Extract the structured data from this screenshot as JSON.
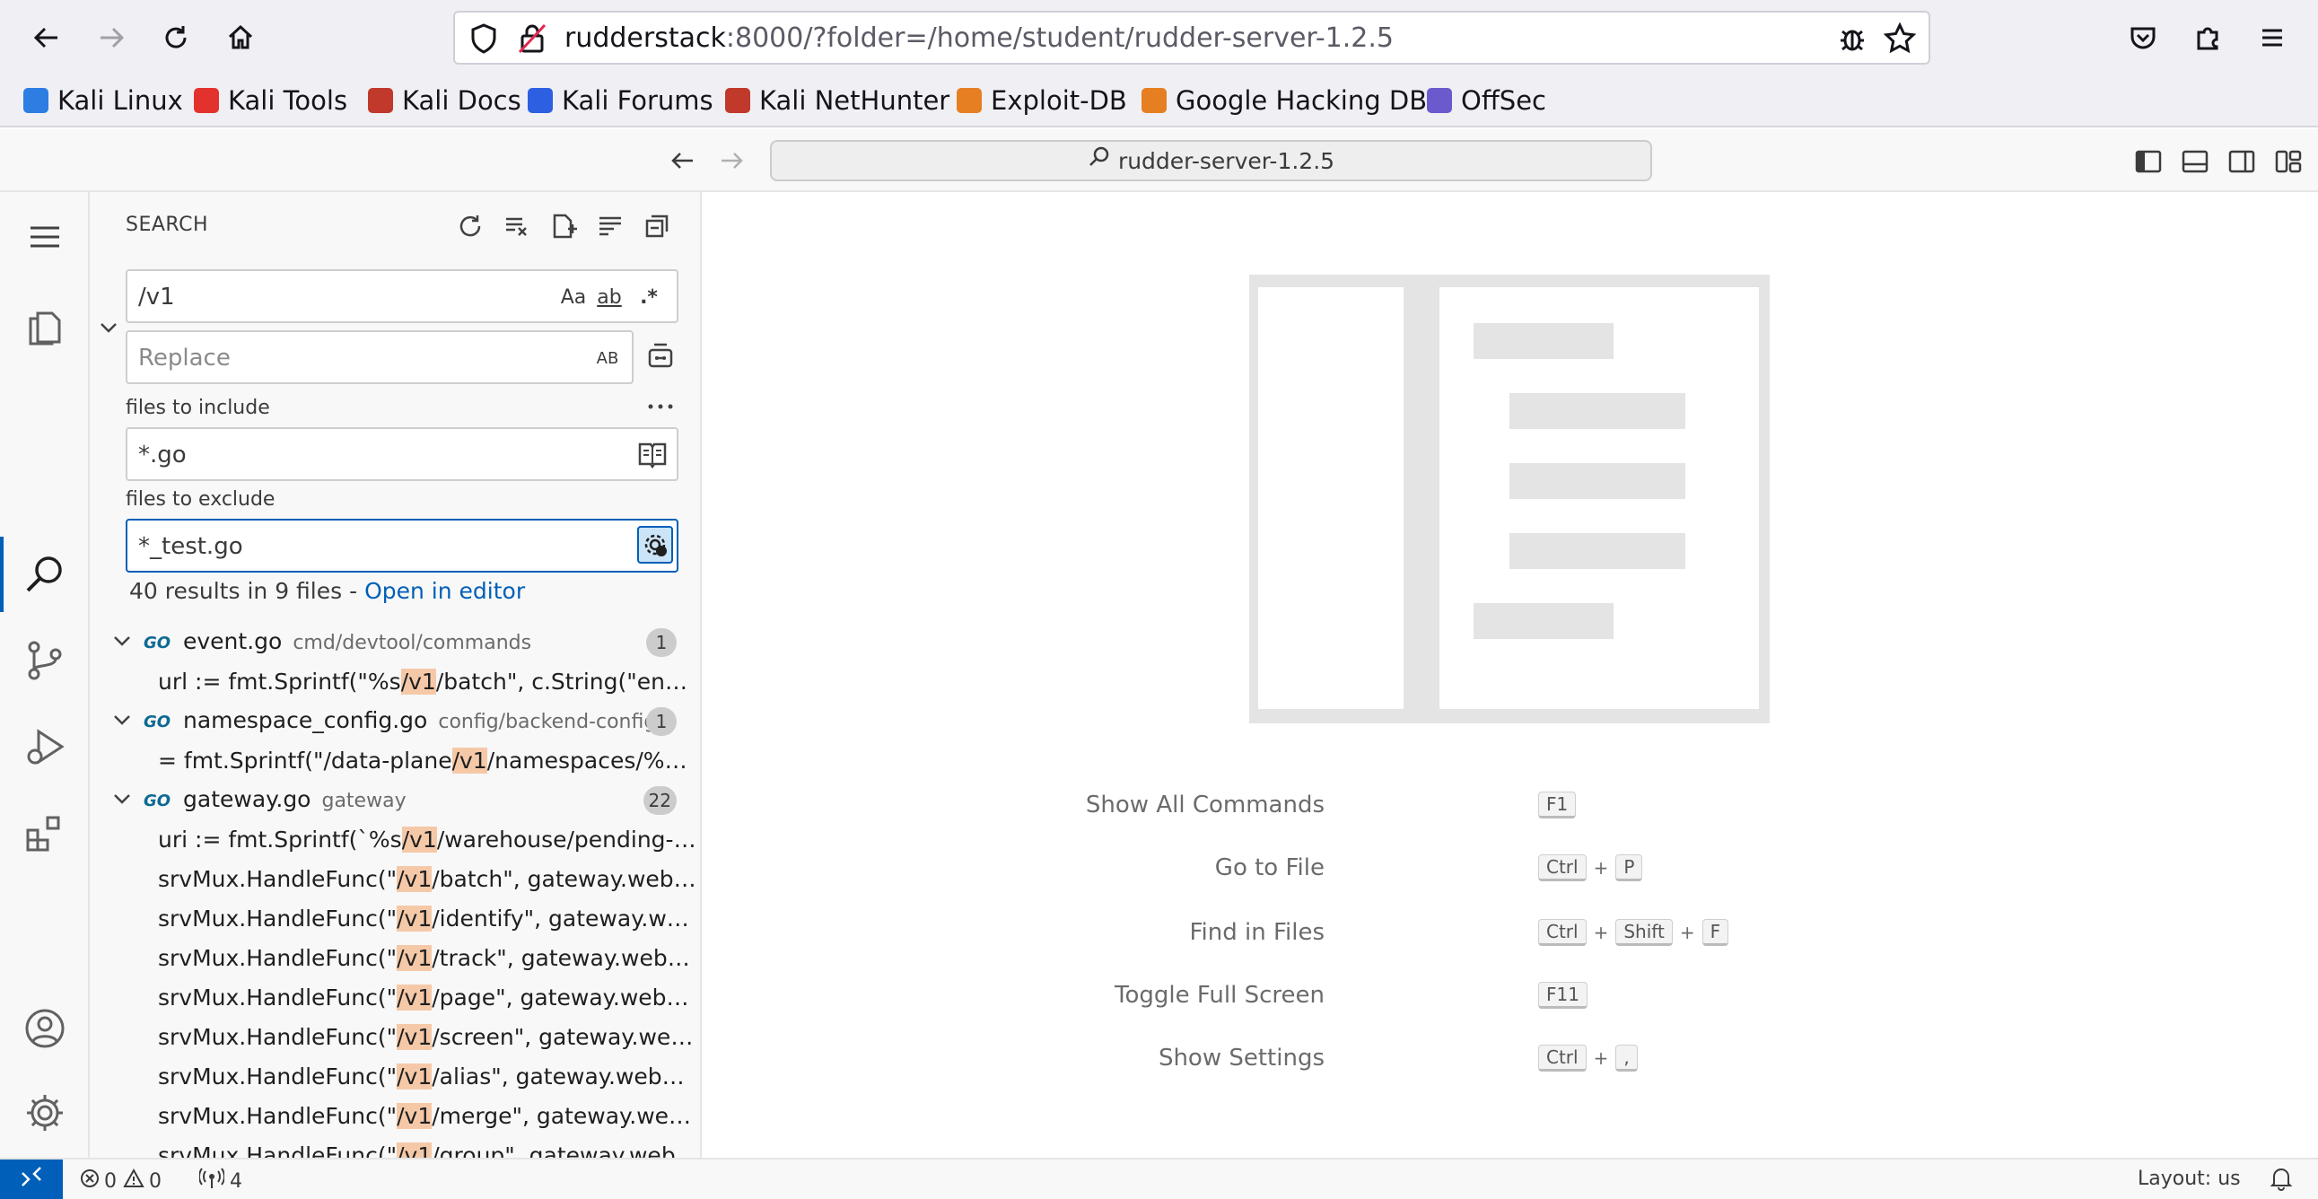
{
  "browser": {
    "url_host": "rudderstack",
    "url_rest": ":8000/?folder=/home/student/rudder-server-1.2.5",
    "bookmarks": [
      {
        "label": "Kali Linux",
        "color": "#2d7de3"
      },
      {
        "label": "Kali Tools",
        "color": "#e3322d"
      },
      {
        "label": "Kali Docs",
        "color": "#c0392b"
      },
      {
        "label": "Kali Forums",
        "color": "#2d5fe3"
      },
      {
        "label": "Kali NetHunter",
        "color": "#c0392b"
      },
      {
        "label": "Exploit-DB",
        "color": "#e67e22"
      },
      {
        "label": "Google Hacking DB",
        "color": "#e67e22"
      },
      {
        "label": "OffSec",
        "color": "#6a5acd"
      }
    ]
  },
  "titlebar": {
    "command_center": "rudder-server-1.2.5"
  },
  "search": {
    "title": "SEARCH",
    "query": "/v1",
    "replace_placeholder": "Replace",
    "match_case": "Aa",
    "whole_word": "ab",
    "regex": ".*",
    "preserve_case": "AB",
    "include_label": "files to include",
    "include_value": "*.go",
    "exclude_label": "files to exclude",
    "exclude_value": "*_test.go",
    "summary": "40 results in 9 files - ",
    "open_in_editor": "Open in editor",
    "go_icon": "GO",
    "results": [
      {
        "file": "event.go",
        "path": "cmd/devtool/commands",
        "count": "1",
        "lines": [
          {
            "pre": "url := fmt.Sprintf(\"%s",
            "match": "/v1",
            "post": "/batch\", c.String(\"endpoin..."
          }
        ]
      },
      {
        "file": "namespace_config.go",
        "path": "config/backend-config",
        "count": "1",
        "lines": [
          {
            "pre": "= fmt.Sprintf(\"/data-plane",
            "match": "/v1",
            "post": "/namespaces/%s/co..."
          }
        ]
      },
      {
        "file": "gateway.go",
        "path": "gateway",
        "count": "22",
        "lines": [
          {
            "pre": "uri := fmt.Sprintf(`%s",
            "match": "/v1",
            "post": "/warehouse/pending-eve..."
          },
          {
            "pre": "srvMux.HandleFunc(\"",
            "match": "/v1",
            "post": "/batch\", gateway.webBat..."
          },
          {
            "pre": "srvMux.HandleFunc(\"",
            "match": "/v1",
            "post": "/identify\", gateway.webId..."
          },
          {
            "pre": "srvMux.HandleFunc(\"",
            "match": "/v1",
            "post": "/track\", gateway.webTrac..."
          },
          {
            "pre": "srvMux.HandleFunc(\"",
            "match": "/v1",
            "post": "/page\", gateway.webPag..."
          },
          {
            "pre": "srvMux.HandleFunc(\"",
            "match": "/v1",
            "post": "/screen\", gateway.webScr..."
          },
          {
            "pre": "srvMux.HandleFunc(\"",
            "match": "/v1",
            "post": "/alias\", gateway.webAlias..."
          },
          {
            "pre": "srvMux.HandleFunc(\"",
            "match": "/v1",
            "post": "/merge\", gateway.webMe..."
          },
          {
            "pre": "srvMux.HandleFunc(\"",
            "match": "/v1",
            "post": "/group\", gateway.webGro..."
          }
        ]
      }
    ]
  },
  "editor": {
    "shortcuts": [
      {
        "label": "Show All Commands",
        "keys": [
          "F1"
        ]
      },
      {
        "label": "Go to File",
        "keys": [
          "Ctrl",
          "P"
        ]
      },
      {
        "label": "Find in Files",
        "keys": [
          "Ctrl",
          "Shift",
          "F"
        ]
      },
      {
        "label": "Toggle Full Screen",
        "keys": [
          "F11"
        ]
      },
      {
        "label": "Show Settings",
        "keys": [
          "Ctrl",
          ","
        ]
      }
    ]
  },
  "statusbar": {
    "errors": "0",
    "warnings": "0",
    "ports": "4",
    "layout": "Layout: us"
  }
}
